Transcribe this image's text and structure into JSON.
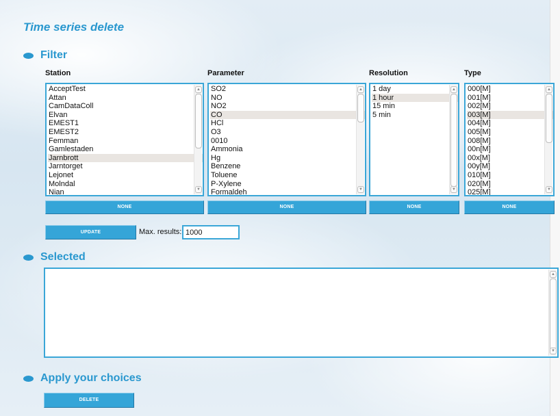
{
  "page": {
    "title": "Time series delete"
  },
  "filter": {
    "heading": "Filter",
    "columns": [
      {
        "label": "Station",
        "items": [
          "AcceptTest",
          "Attan",
          "CamDataColl",
          "Elvan",
          "EMEST1",
          "EMEST2",
          "Femman",
          "Gamlestaden",
          "Jarnbrott",
          "Jarntorget",
          "Lejonet",
          "Molndal",
          "Nian"
        ],
        "selected": "Jarnbrott",
        "none_label": "NONE"
      },
      {
        "label": "Parameter",
        "items": [
          "SO2",
          "NO",
          "NO2",
          "CO",
          "HCl",
          "O3",
          "0010",
          "Ammonia",
          "Hg",
          "Benzene",
          "Toluene",
          "P-Xylene",
          "Formaldeh"
        ],
        "selected": "CO",
        "none_label": "NONE"
      },
      {
        "label": "Resolution",
        "items": [
          "1 day",
          "1 hour",
          "15 min",
          "5 min"
        ],
        "selected": "1 hour",
        "none_label": "NONE"
      },
      {
        "label": "Type",
        "items": [
          "000[M]",
          "001[M]",
          "002[M]",
          "003[M]",
          "004[M]",
          "005[M]",
          "008[M]",
          "00n[M]",
          "00x[M]",
          "00y[M]",
          "010[M]",
          "020[M]",
          "025[M]"
        ],
        "selected": "003[M]",
        "none_label": "NONE"
      }
    ],
    "update_label": "UPDATE",
    "max_results_label": "Max. results:",
    "max_results_value": "1000"
  },
  "selected": {
    "heading": "Selected",
    "items": []
  },
  "apply": {
    "heading": "Apply your choices",
    "delete_label": "DELETE"
  }
}
